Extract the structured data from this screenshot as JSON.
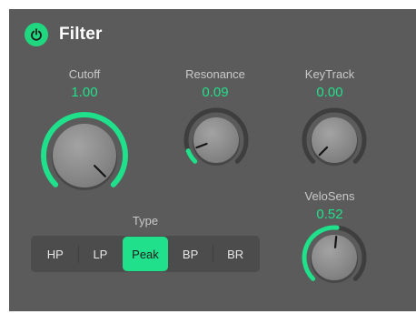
{
  "header": {
    "title": "Filter",
    "power_on": true
  },
  "colors": {
    "accent": "#21e08b",
    "panel": "#5b5b5b",
    "track": "#3e3e3e",
    "knob_body": "#8e8e8e",
    "label": "#c9c9c9"
  },
  "knobs": {
    "cutoff": {
      "label": "Cutoff",
      "value": "1.00",
      "fraction": 1.0
    },
    "resonance": {
      "label": "Resonance",
      "value": "0.09",
      "fraction": 0.09
    },
    "keytrack": {
      "label": "KeyTrack",
      "value": "0.00",
      "fraction": 0.0
    },
    "velosens": {
      "label": "VeloSens",
      "value": "0.52",
      "fraction": 0.52
    }
  },
  "type": {
    "label": "Type",
    "options": [
      "HP",
      "LP",
      "Peak",
      "BP",
      "BR"
    ],
    "selected": "Peak"
  }
}
